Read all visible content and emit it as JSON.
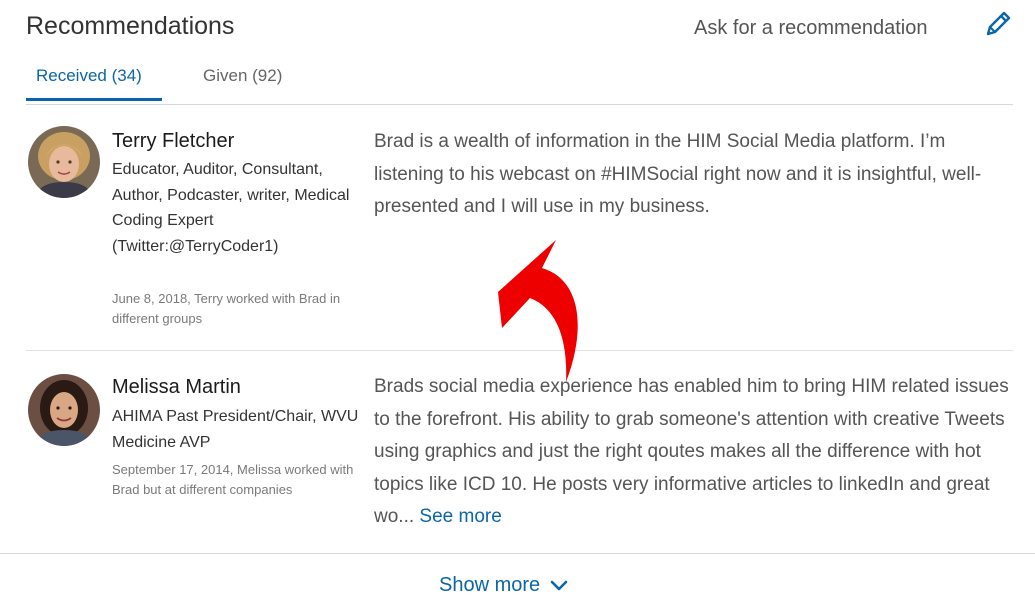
{
  "section": {
    "title": "Recommendations",
    "ask_label": "Ask for a recommendation"
  },
  "tabs": [
    {
      "label": "Received (34)",
      "active": true
    },
    {
      "label": "Given (92)",
      "active": false
    }
  ],
  "recommendations": [
    {
      "name": "Terry Fletcher",
      "headline": "Educator, Auditor, Consultant, Author, Podcaster, writer, Medical Coding Expert (Twitter:@TerryCoder1)",
      "meta": "June 8, 2018, Terry worked with Brad in different groups",
      "text": "Brad is a wealth of information in the HIM Social Media platform. I’m listening to his webcast on #HIMSocial right now and it is insightful, well-presented and I will use in my business."
    },
    {
      "name": "Melissa Martin",
      "headline": "AHIMA Past President/Chair, WVU Medicine AVP",
      "meta": "September 17, 2014, Melissa worked with Brad but at different companies",
      "text": "Brads social media experience has enabled him to bring HIM related issues to the forefront. His ability to grab someone's attention with creative Tweets using graphics and just the right qoutes makes all the difference with hot topics like ICD 10. He posts very informative articles to linkedIn and great wo...",
      "see_more": "See more"
    }
  ],
  "footer": {
    "show_more_label": "Show more"
  },
  "icons": {
    "edit": "pencil-icon",
    "expand": "chevron-down-icon"
  },
  "colors": {
    "accent": "#0a66a8",
    "annotation_arrow": "#ee0000"
  }
}
